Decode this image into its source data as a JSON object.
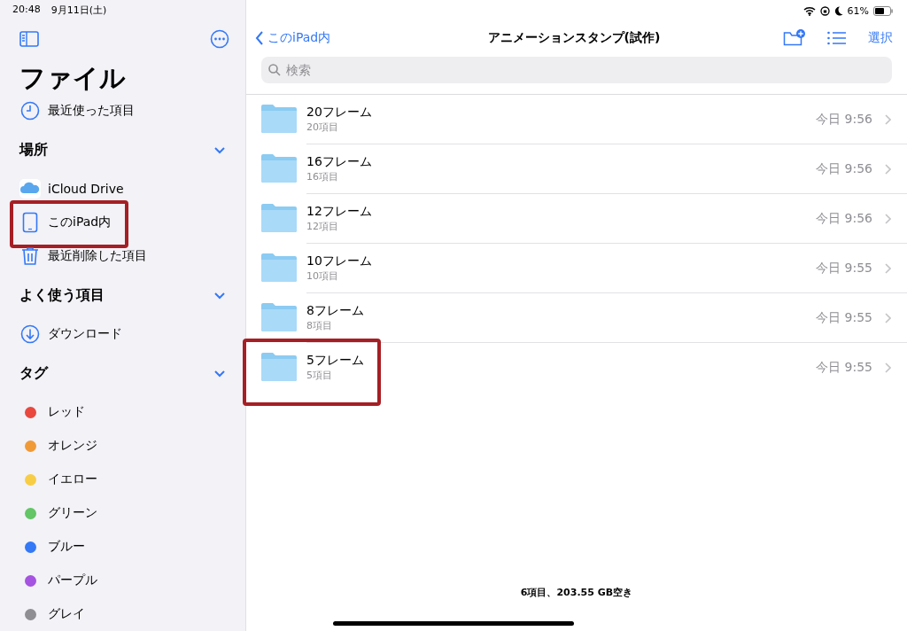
{
  "status_bar": {
    "time": "20:48",
    "date": "9月11日(土)",
    "battery": "61%"
  },
  "sidebar": {
    "title": "ファイル",
    "top_items": [
      {
        "kind": "clock",
        "label": "最近使った項目",
        "highlighted": false
      }
    ],
    "sections": [
      {
        "title": "場所",
        "expanded": true,
        "items": [
          {
            "kind": "icloud",
            "label": "iCloud Drive",
            "highlighted": false
          },
          {
            "kind": "ipad",
            "label": "このiPad内",
            "highlighted": true
          },
          {
            "kind": "trash",
            "label": "最近削除した項目",
            "highlighted": false
          }
        ]
      },
      {
        "title": "よく使う項目",
        "expanded": true,
        "items": [
          {
            "kind": "download",
            "label": "ダウンロード",
            "highlighted": false
          }
        ]
      },
      {
        "title": "タグ",
        "expanded": true,
        "items": [
          {
            "kind": "tag",
            "label": "レッド",
            "color": "#e8483e",
            "highlighted": false
          },
          {
            "kind": "tag",
            "label": "オレンジ",
            "color": "#f09a37",
            "highlighted": false
          },
          {
            "kind": "tag",
            "label": "イエロー",
            "color": "#f8cd46",
            "highlighted": false
          },
          {
            "kind": "tag",
            "label": "グリーン",
            "color": "#63c565",
            "highlighted": false
          },
          {
            "kind": "tag",
            "label": "ブルー",
            "color": "#3478f6",
            "highlighted": false
          },
          {
            "kind": "tag",
            "label": "パープル",
            "color": "#a553e0",
            "highlighted": false
          },
          {
            "kind": "tag",
            "label": "グレイ",
            "color": "#8e8e93",
            "highlighted": false
          }
        ]
      }
    ]
  },
  "main": {
    "back": "このiPad内",
    "title": "アニメーションスタンプ(試作)",
    "select": "選択",
    "search": {
      "placeholder": "検索"
    },
    "folders": [
      {
        "name": "20フレーム",
        "count": "20項目",
        "date": "今日 9:56",
        "highlighted": false
      },
      {
        "name": "16フレーム",
        "count": "16項目",
        "date": "今日 9:56",
        "highlighted": false
      },
      {
        "name": "12フレーム",
        "count": "12項目",
        "date": "今日 9:56",
        "highlighted": false
      },
      {
        "name": "10フレーム",
        "count": "10項目",
        "date": "今日 9:55",
        "highlighted": false
      },
      {
        "name": "8フレーム",
        "count": "8項目",
        "date": "今日 9:55",
        "highlighted": false
      },
      {
        "name": "5フレーム",
        "count": "5項目",
        "date": "今日 9:55",
        "highlighted": true
      }
    ],
    "footer": "6項目、203.55 GB空き"
  }
}
